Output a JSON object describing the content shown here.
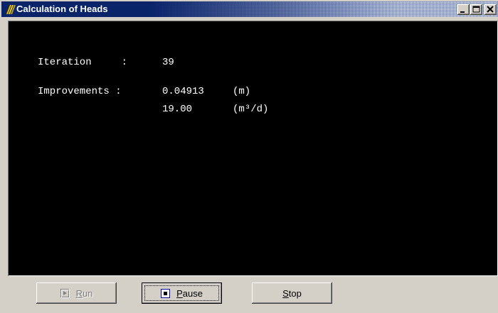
{
  "window": {
    "title": "Calculation of Heads"
  },
  "console": {
    "iteration_label": "Iteration     : ",
    "iteration_value": "39",
    "improvements_label": "Improvements : ",
    "head_improvement_value": "0.04913",
    "head_improvement_unit": "(m)",
    "flow_improvement_value": "19.00",
    "flow_improvement_unit": "(m³/d)"
  },
  "buttons": {
    "run": {
      "label_first": "R",
      "label_rest": "un",
      "enabled": false
    },
    "pause": {
      "label_first": "P",
      "label_rest": "ause",
      "enabled": true
    },
    "stop": {
      "label_first": "S",
      "label_rest": "top",
      "enabled": true
    }
  },
  "colors": {
    "titlebar": "#0a246a",
    "console_bg": "#000000",
    "console_text": "#ffffff",
    "face": "#d4d0c8"
  },
  "icons": [
    "app-icon",
    "minimize-icon",
    "maximize-icon",
    "close-icon",
    "play-icon",
    "pause-icon"
  ]
}
